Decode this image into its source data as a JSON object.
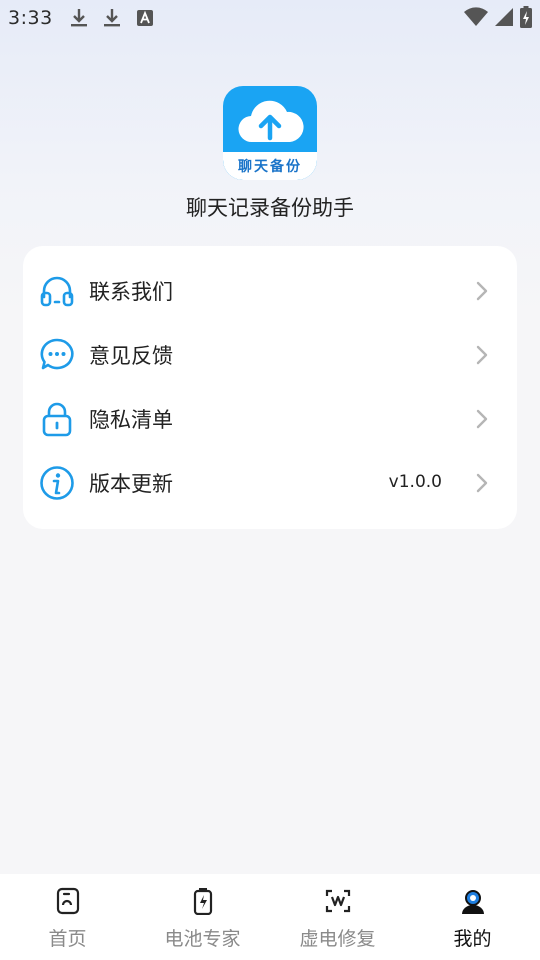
{
  "status_bar": {
    "time": "3:33",
    "left_icons": [
      "download-icon",
      "download-icon",
      "a-notification-icon"
    ],
    "right_icons": [
      "wifi-icon",
      "signal-icon",
      "battery-charging-icon"
    ]
  },
  "header": {
    "logo_text": "聊天备份",
    "app_name": "聊天记录备份助手"
  },
  "menu": {
    "items": [
      {
        "label": "联系我们",
        "icon": "headset-icon"
      },
      {
        "label": "意见反馈",
        "icon": "chat-bubble-icon"
      },
      {
        "label": "隐私清单",
        "icon": "lock-icon"
      },
      {
        "label": "版本更新",
        "icon": "info-icon",
        "value": "v1.0.0"
      }
    ]
  },
  "bottom_nav": {
    "items": [
      {
        "label": "首页",
        "icon": "home-icon",
        "active": false
      },
      {
        "label": "电池专家",
        "icon": "battery-icon",
        "active": false
      },
      {
        "label": "虚电修复",
        "icon": "scan-repair-icon",
        "active": false
      },
      {
        "label": "我的",
        "icon": "profile-icon",
        "active": true
      }
    ]
  },
  "colors": {
    "accent": "#1e9be8",
    "logo_blue": "#1aa4f3",
    "chevron": "#b5b5b5",
    "inactive_nav": "#8a8a8a"
  }
}
